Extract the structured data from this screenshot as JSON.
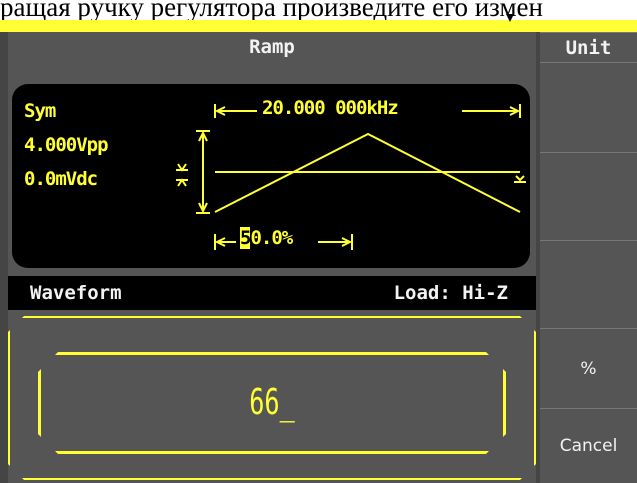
{
  "caption": "ращая ручку регулятора произведите его измен",
  "title": "Ramp",
  "params": {
    "mode": "Sym",
    "amplitude": "4.000Vpp",
    "offset": "0.0mVdc"
  },
  "waveform": {
    "frequency": "20.000 000kHz",
    "symmetry_cursor_digit": "5",
    "symmetry_rest": "0.0%"
  },
  "status": {
    "waveform_label": "Waveform",
    "load_label": "Load: Hi-Z"
  },
  "input": {
    "value": "66_"
  },
  "softkeys": {
    "header": "Unit",
    "percent": "%",
    "cancel": "Cancel"
  },
  "colors": {
    "accent": "#ffff33",
    "screen_bg": "#555555",
    "panel_bg": "#000000"
  }
}
